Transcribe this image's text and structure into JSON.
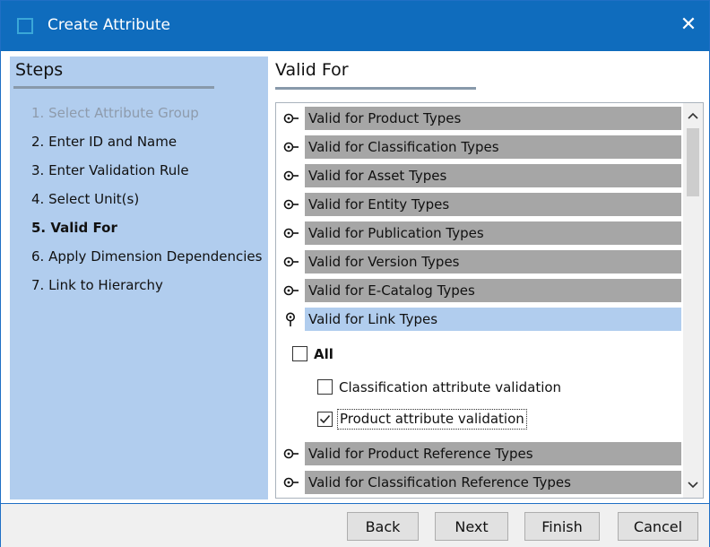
{
  "window": {
    "title": "Create Attribute",
    "close_icon": "✕"
  },
  "steps": {
    "title": "Steps",
    "items": [
      {
        "label": "1. Select Attribute Group",
        "state": "done"
      },
      {
        "label": "2. Enter ID and Name",
        "state": "normal"
      },
      {
        "label": "3. Enter Validation Rule",
        "state": "normal"
      },
      {
        "label": "4. Select Unit(s)",
        "state": "normal"
      },
      {
        "label": "5. Valid For",
        "state": "active"
      },
      {
        "label": "6. Apply Dimension Dependencies",
        "state": "normal"
      },
      {
        "label": "7. Link to Hierarchy",
        "state": "normal"
      }
    ]
  },
  "content": {
    "title": "Valid For",
    "rows": [
      {
        "label": "Valid for Product Types",
        "expanded": false
      },
      {
        "label": "Valid for Classification Types",
        "expanded": false
      },
      {
        "label": "Valid for Asset Types",
        "expanded": false
      },
      {
        "label": "Valid for Entity Types",
        "expanded": false
      },
      {
        "label": "Valid for Publication Types",
        "expanded": false
      },
      {
        "label": "Valid for Version Types",
        "expanded": false
      },
      {
        "label": "Valid for E-Catalog Types",
        "expanded": false
      },
      {
        "label": "Valid for Link Types",
        "expanded": true
      },
      {
        "label": "Valid for Product Reference Types",
        "expanded": false
      },
      {
        "label": "Valid for Classification Reference Types",
        "expanded": false
      }
    ],
    "checkboxes": {
      "all": {
        "label": "All",
        "checked": false
      },
      "items": [
        {
          "label": "Classification attribute validation",
          "checked": false
        },
        {
          "label": "Product attribute validation",
          "checked": true
        }
      ]
    }
  },
  "buttons": {
    "back": "Back",
    "next": "Next",
    "finish": "Finish",
    "cancel": "Cancel"
  },
  "colors": {
    "titlebar": "#0f6cbd",
    "steps_panel": "#b1cdee",
    "row_gray": "#a6a6a6",
    "row_selected": "#b1cdee"
  }
}
